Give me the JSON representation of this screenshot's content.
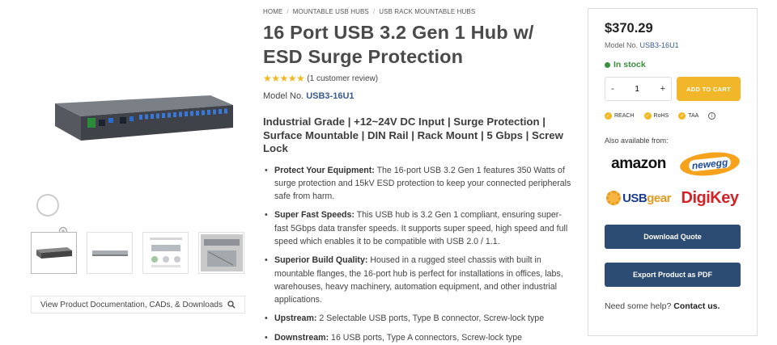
{
  "breadcrumb": {
    "home": "HOME",
    "sep": "/",
    "cat1": "MOUNTABLE USB HUBS",
    "cat2": "USB RACK MOUNTABLE HUBS"
  },
  "product": {
    "title": "16 Port USB 3.2 Gen 1 Hub w/ ESD Surge Protection",
    "stars": "★★★★★",
    "rating_value": 5,
    "review_text": "(1 customer review)",
    "model_label": "Model No.",
    "model_number": "USB3-16U1",
    "subtitle": "Industrial Grade | +12~24V DC Input | Surge Protection | Surface Mountable | DIN Rail | Rack Mount | 5 Gbps | Screw Lock",
    "features": [
      {
        "label": "Protect Your Equipment:",
        "text": " The 16-port USB 3.2 Gen 1 features 350 Watts of surge protection and 15kV ESD protection to keep your connected peripherals safe from harm."
      },
      {
        "label": "Super Fast Speeds:",
        "text": " This USB hub is 3.2 Gen 1 compliant, ensuring super-fast 5Gbps data transfer speeds. It supports super speed, high speed and full speed which enables it to be compatible with USB 2.0 / 1.1."
      },
      {
        "label": "Superior Build Quality:",
        "text": " Housed in a rugged steel chassis with built in mountable flanges, the 16-port hub is perfect for installations in offices, labs, warehouses, heavy machinery, automation equipment, and other industrial applications."
      },
      {
        "label": "Upstream:",
        "text": " 2 Selectable USB ports, Type B connector, Screw-lock type"
      },
      {
        "label": "Downstream:",
        "text": " 16 USB ports, Type A connectors, Screw-lock type"
      }
    ]
  },
  "gallery": {
    "doc_link": "View Product Documentation, CADs, & Downloads",
    "zoom_icon": "zoom-in-icon",
    "search_icon": "search-icon"
  },
  "buybox": {
    "price": "$370.29",
    "model_label": "Model No.",
    "model_number": "USB3-16U1",
    "stock": "In stock",
    "qty_minus": "-",
    "qty_value": "1",
    "qty_plus": "+",
    "add_to_cart": "ADD TO CART",
    "certs": [
      "REACH",
      "RoHS",
      "TAA"
    ],
    "also_available": "Also available from:",
    "retailers": {
      "amazon": "amazon",
      "newegg": "newegg",
      "usbgear_a": "USB",
      "usbgear_b": "gear",
      "digikey": "DigiKey"
    },
    "download_quote": "Download Quote",
    "export_pdf": "Export Product as PDF",
    "help_text": "Need some help?",
    "contact": "Contact us."
  },
  "colors": {
    "accent": "#f1b62a",
    "button_blue": "#2d4c73",
    "stock_green": "#3a8f3e",
    "star": "#f3b820"
  }
}
